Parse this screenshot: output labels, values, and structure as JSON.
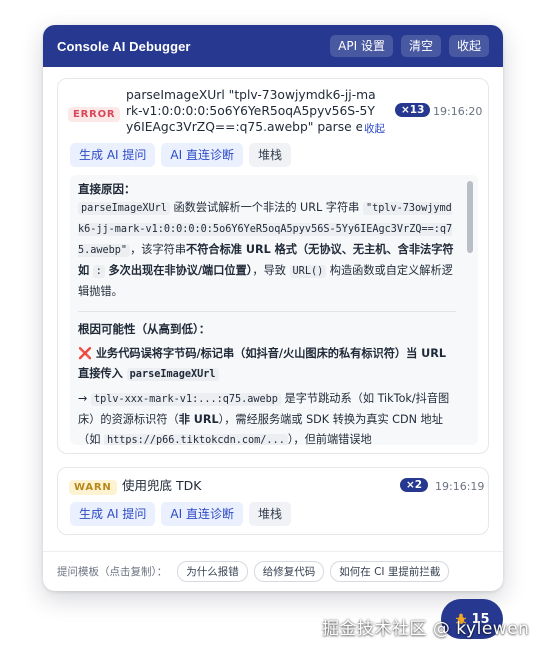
{
  "header": {
    "title": "Console AI Debugger",
    "api_settings": "API 设置",
    "clear": "清空",
    "collapse": "收起"
  },
  "error_log": {
    "level": "ERROR",
    "message": "parseImageXUrl \"tplv-73owjymdk6-jj-mark-v1:0:0:0:0:5o6Y6YeR5oqA5pyv56S-5Yy6IEAgc3VrZQ==:q75.awebp\" parse err",
    "collapse_link": "收起",
    "count": "×13",
    "time": "19:16:20",
    "actions": {
      "gen_prompt": "生成 AI 提问",
      "ai_diagnose": "AI 直连诊断",
      "stack": "堆栈"
    },
    "detail": {
      "direct_cause_title": "直接原因：",
      "fn_name": "parseImageXUrl",
      "p1_a": "函数尝试解析一个非法的 URL 字符串",
      "url_code": "\"tplv-73owjymdk6-jj-mark-v1:0:0:0:0:5o6Y6YeR5oqA5pyv56S-5Yy6IEAgc3VrZQ==:q75.awebp\"",
      "p1_b": "，该字符串",
      "p1_bold1": "不符合标准 URL 格式",
      "p1_bold2": "（无协议、无主机、含非法字符如",
      "colon_code": ":",
      "p1_bold3": "多次出现在非协议/端口位置）",
      "p1_c": "，导致",
      "url_ctor": "URL()",
      "p1_d": "构造函数或自定义解析逻辑抛错。",
      "causes_title": "根因可能性（从高到低）：",
      "cross": "❌",
      "cause1_bold": "业务代码误将字节码/标记串（如抖音/火山图床的私有标识符）当 URL 直接传入",
      "cause1_code": "parseImageXUrl",
      "arrow": "→",
      "p2_code": "tplv-xxx-mark-v1:...:q75.awebp",
      "p2_a": "是字节跳动系（如 TikTok/抖音图床）的资源标识符（",
      "p2_bold": "非 URL",
      "p2_b": "），需经服务端或 SDK 转换为真实 CDN 地址（如",
      "p2_code2": "https://p66.tiktokcdn.com/...",
      "p2_c": "），但前端错误地"
    }
  },
  "warn_log": {
    "level": "WARN",
    "message": "使用兜底 TDK",
    "count": "×2",
    "time": "19:16:19",
    "actions": {
      "gen_prompt": "生成 AI 提问",
      "ai_diagnose": "AI 直连诊断",
      "stack": "堆栈"
    }
  },
  "footer": {
    "label": "提问模板（点击复制）：",
    "templates": [
      "为什么报错",
      "给修复代码",
      "如何在 CI 里提前拦截"
    ]
  },
  "fab": {
    "icon": "bug-icon",
    "count": "15"
  },
  "watermark": "掘金技术社区 @ kylewen",
  "colors": {
    "primary": "#26388f",
    "error": "#d9485a",
    "warn": "#b7891a"
  }
}
